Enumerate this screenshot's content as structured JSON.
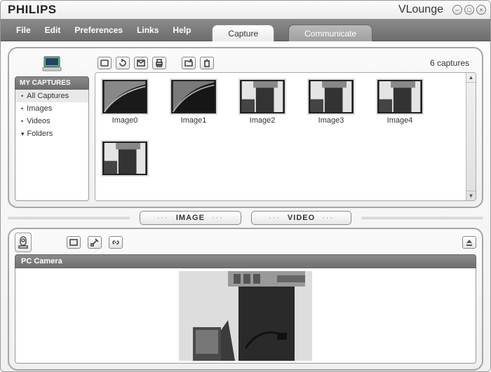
{
  "window": {
    "brand": "PHILIPS",
    "appname": "VLounge"
  },
  "menu": {
    "file": "File",
    "edit": "Edit",
    "preferences": "Preferences",
    "links": "Links",
    "help": "Help"
  },
  "tabs": {
    "capture": "Capture",
    "communicate": "Communicate"
  },
  "sidebar": {
    "heading": "MY CAPTURES",
    "items": [
      "All Captures",
      "Images",
      "Videos",
      "Folders"
    ],
    "selected": 0
  },
  "gallery": {
    "count_text": "6 captures",
    "thumbs": [
      "Image0",
      "Image1",
      "Image2",
      "Image3",
      "Image4",
      ""
    ]
  },
  "pills": {
    "image": "IMAGE",
    "video": "VIDEO"
  },
  "camera": {
    "heading": "PC Camera"
  }
}
